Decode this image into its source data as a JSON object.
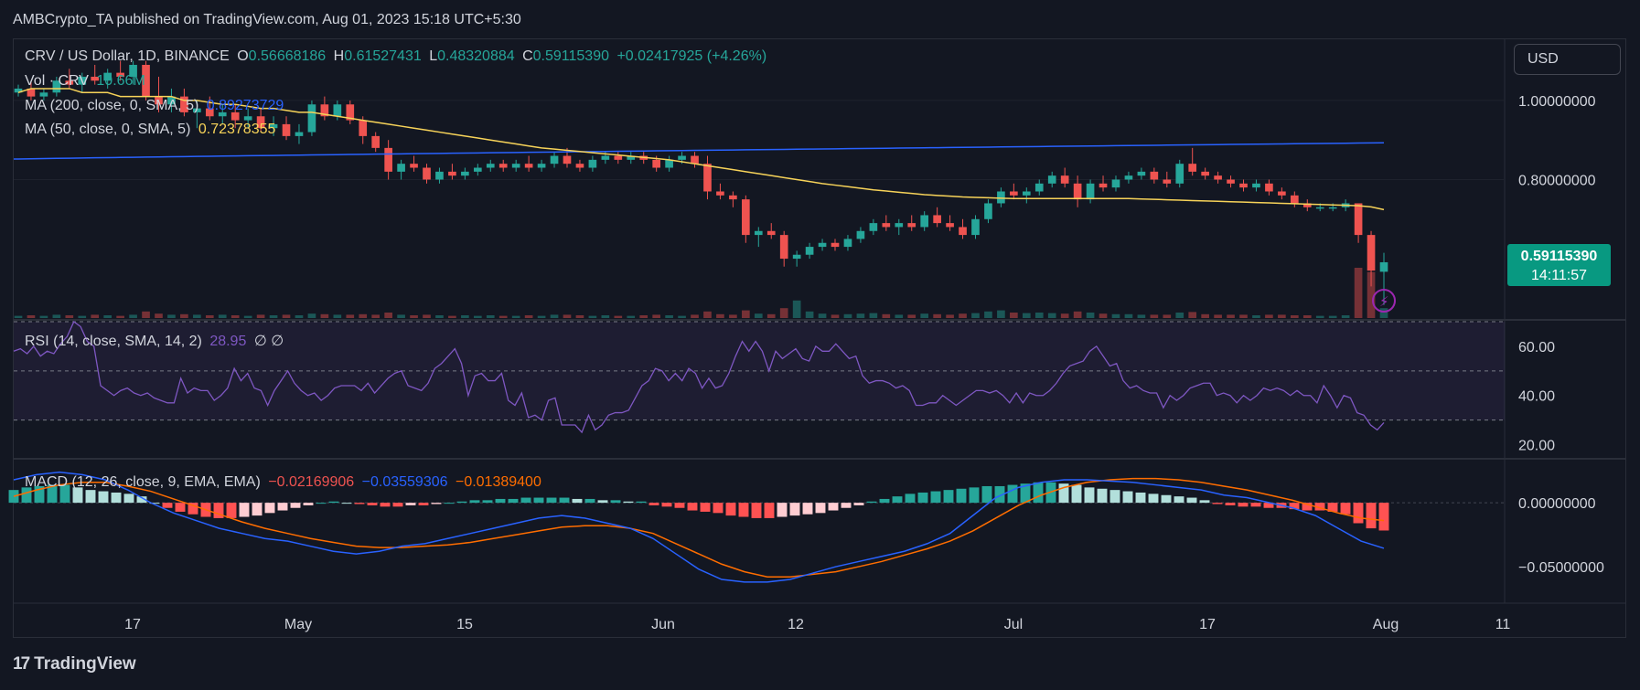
{
  "header": {
    "publisher": "AMBCrypto_TA published on TradingView.com, Aug 01, 2023 15:18 UTC+5:30"
  },
  "symbol": {
    "name": "CRV / US Dollar, 1D, BINANCE",
    "o_label": "O",
    "o": "0.56668186",
    "h_label": "H",
    "h": "0.61527431",
    "l_label": "L",
    "l": "0.48320884",
    "c_label": "C",
    "c": "0.59115390",
    "change": "+0.02417925 (+4.26%)"
  },
  "vol": {
    "label": "Vol · CRV",
    "value": "10.66M"
  },
  "ma200": {
    "label": "MA (200, close, 0, SMA, 5)",
    "value": "0.89273729"
  },
  "ma50": {
    "label": "MA (50, close, 0, SMA, 5)",
    "value": "0.72378355"
  },
  "rsi": {
    "label": "RSI (14, close, SMA, 14, 2)",
    "value": "28.95",
    "extra": "∅ ∅"
  },
  "macd": {
    "label": "MACD (12, 26, close, 9, EMA, EMA)",
    "v1": "−0.02169906",
    "v2": "−0.03559306",
    "v3": "−0.01389400"
  },
  "currency": "USD",
  "price_tag": {
    "price": "0.59115390",
    "countdown": "14:11:57"
  },
  "footer": {
    "brand": "TradingView",
    "logo": "17"
  },
  "colors": {
    "up": "#26a69a",
    "down": "#ef5350",
    "ma200": "#2962ff",
    "ma50": "#f7d359",
    "rsi": "#7e57c2",
    "macd": "#2962ff",
    "signal": "#ff6d00",
    "bg": "#131722"
  },
  "chart_data": {
    "type": "candlestick",
    "price_axis": {
      "ticks": [
        "1.00000000",
        "0.80000000"
      ],
      "range": [
        0.45,
        1.15
      ]
    },
    "x_ticks": [
      "17",
      "May",
      "15",
      "Jun",
      "12",
      "Jul",
      "17",
      "Aug",
      "11"
    ],
    "candles": [
      [
        1.02,
        1.04,
        1.01,
        1.03
      ],
      [
        1.03,
        1.05,
        1.0,
        1.01
      ],
      [
        1.01,
        1.03,
        1.0,
        1.02
      ],
      [
        1.02,
        1.06,
        1.01,
        1.05
      ],
      [
        1.05,
        1.08,
        1.03,
        1.04
      ],
      [
        1.04,
        1.07,
        1.02,
        1.06
      ],
      [
        1.06,
        1.09,
        1.04,
        1.05
      ],
      [
        1.05,
        1.08,
        1.03,
        1.07
      ],
      [
        1.07,
        1.1,
        1.05,
        1.06
      ],
      [
        1.06,
        1.1,
        1.04,
        1.09
      ],
      [
        1.09,
        1.1,
        1.0,
        1.01
      ],
      [
        1.01,
        1.06,
        0.97,
        0.99
      ],
      [
        0.99,
        1.03,
        0.97,
        1.01
      ],
      [
        1.01,
        1.03,
        0.96,
        0.97
      ],
      [
        0.97,
        1.0,
        0.93,
        0.98
      ],
      [
        0.98,
        1.01,
        0.95,
        0.96
      ],
      [
        0.96,
        0.99,
        0.94,
        0.97
      ],
      [
        0.97,
        0.99,
        0.93,
        0.95
      ],
      [
        0.95,
        0.98,
        0.93,
        0.96
      ],
      [
        0.96,
        0.98,
        0.92,
        0.93
      ],
      [
        0.93,
        0.96,
        0.91,
        0.94
      ],
      [
        0.94,
        0.96,
        0.9,
        0.91
      ],
      [
        0.91,
        0.94,
        0.89,
        0.92
      ],
      [
        0.92,
        1.0,
        0.91,
        0.99
      ],
      [
        0.99,
        1.01,
        0.95,
        0.96
      ],
      [
        0.96,
        1.0,
        0.95,
        0.99
      ],
      [
        0.99,
        1.0,
        0.94,
        0.95
      ],
      [
        0.95,
        0.96,
        0.89,
        0.91
      ],
      [
        0.91,
        0.92,
        0.87,
        0.88
      ],
      [
        0.88,
        0.9,
        0.8,
        0.82
      ],
      [
        0.82,
        0.85,
        0.8,
        0.84
      ],
      [
        0.84,
        0.86,
        0.82,
        0.83
      ],
      [
        0.83,
        0.84,
        0.79,
        0.8
      ],
      [
        0.8,
        0.83,
        0.79,
        0.82
      ],
      [
        0.82,
        0.84,
        0.8,
        0.81
      ],
      [
        0.81,
        0.83,
        0.8,
        0.82
      ],
      [
        0.82,
        0.84,
        0.81,
        0.83
      ],
      [
        0.83,
        0.85,
        0.82,
        0.84
      ],
      [
        0.84,
        0.85,
        0.82,
        0.83
      ],
      [
        0.83,
        0.85,
        0.82,
        0.84
      ],
      [
        0.84,
        0.86,
        0.82,
        0.83
      ],
      [
        0.83,
        0.85,
        0.82,
        0.84
      ],
      [
        0.84,
        0.87,
        0.83,
        0.86
      ],
      [
        0.86,
        0.88,
        0.83,
        0.84
      ],
      [
        0.84,
        0.85,
        0.82,
        0.83
      ],
      [
        0.83,
        0.86,
        0.82,
        0.85
      ],
      [
        0.85,
        0.87,
        0.84,
        0.86
      ],
      [
        0.86,
        0.87,
        0.84,
        0.85
      ],
      [
        0.85,
        0.87,
        0.84,
        0.86
      ],
      [
        0.86,
        0.87,
        0.84,
        0.85
      ],
      [
        0.85,
        0.86,
        0.82,
        0.83
      ],
      [
        0.83,
        0.86,
        0.82,
        0.85
      ],
      [
        0.85,
        0.87,
        0.84,
        0.86
      ],
      [
        0.86,
        0.87,
        0.83,
        0.84
      ],
      [
        0.84,
        0.86,
        0.75,
        0.77
      ],
      [
        0.77,
        0.79,
        0.75,
        0.76
      ],
      [
        0.76,
        0.77,
        0.73,
        0.75
      ],
      [
        0.75,
        0.76,
        0.64,
        0.66
      ],
      [
        0.66,
        0.68,
        0.63,
        0.67
      ],
      [
        0.67,
        0.69,
        0.65,
        0.66
      ],
      [
        0.66,
        0.67,
        0.58,
        0.6
      ],
      [
        0.6,
        0.62,
        0.58,
        0.61
      ],
      [
        0.61,
        0.64,
        0.6,
        0.63
      ],
      [
        0.63,
        0.65,
        0.62,
        0.64
      ],
      [
        0.64,
        0.65,
        0.62,
        0.63
      ],
      [
        0.63,
        0.66,
        0.62,
        0.65
      ],
      [
        0.65,
        0.68,
        0.64,
        0.67
      ],
      [
        0.67,
        0.7,
        0.66,
        0.69
      ],
      [
        0.69,
        0.71,
        0.67,
        0.68
      ],
      [
        0.68,
        0.7,
        0.66,
        0.69
      ],
      [
        0.69,
        0.71,
        0.67,
        0.68
      ],
      [
        0.68,
        0.72,
        0.67,
        0.71
      ],
      [
        0.71,
        0.73,
        0.68,
        0.69
      ],
      [
        0.69,
        0.71,
        0.67,
        0.68
      ],
      [
        0.68,
        0.7,
        0.65,
        0.66
      ],
      [
        0.66,
        0.71,
        0.65,
        0.7
      ],
      [
        0.7,
        0.75,
        0.69,
        0.74
      ],
      [
        0.74,
        0.78,
        0.73,
        0.77
      ],
      [
        0.77,
        0.79,
        0.75,
        0.76
      ],
      [
        0.76,
        0.78,
        0.74,
        0.77
      ],
      [
        0.77,
        0.8,
        0.76,
        0.79
      ],
      [
        0.79,
        0.82,
        0.78,
        0.81
      ],
      [
        0.81,
        0.83,
        0.78,
        0.79
      ],
      [
        0.79,
        0.81,
        0.73,
        0.75
      ],
      [
        0.75,
        0.8,
        0.74,
        0.79
      ],
      [
        0.79,
        0.81,
        0.77,
        0.78
      ],
      [
        0.78,
        0.81,
        0.77,
        0.8
      ],
      [
        0.8,
        0.82,
        0.79,
        0.81
      ],
      [
        0.81,
        0.83,
        0.8,
        0.82
      ],
      [
        0.82,
        0.83,
        0.79,
        0.8
      ],
      [
        0.8,
        0.82,
        0.78,
        0.79
      ],
      [
        0.79,
        0.85,
        0.78,
        0.84
      ],
      [
        0.84,
        0.88,
        0.81,
        0.82
      ],
      [
        0.82,
        0.83,
        0.8,
        0.81
      ],
      [
        0.81,
        0.82,
        0.79,
        0.8
      ],
      [
        0.8,
        0.81,
        0.78,
        0.79
      ],
      [
        0.79,
        0.8,
        0.77,
        0.78
      ],
      [
        0.78,
        0.8,
        0.77,
        0.79
      ],
      [
        0.79,
        0.8,
        0.76,
        0.77
      ],
      [
        0.77,
        0.78,
        0.75,
        0.76
      ],
      [
        0.76,
        0.77,
        0.73,
        0.74
      ],
      [
        0.74,
        0.75,
        0.72,
        0.73
      ],
      [
        0.73,
        0.74,
        0.72,
        0.73
      ],
      [
        0.73,
        0.74,
        0.72,
        0.73
      ],
      [
        0.73,
        0.75,
        0.72,
        0.74
      ],
      [
        0.74,
        0.74,
        0.64,
        0.66
      ],
      [
        0.66,
        0.67,
        0.53,
        0.57
      ],
      [
        0.567,
        0.615,
        0.483,
        0.591
      ]
    ],
    "volume_relative": [
      0.2,
      0.25,
      0.2,
      0.3,
      0.25,
      0.2,
      0.3,
      0.25,
      0.2,
      0.3,
      0.6,
      0.4,
      0.3,
      0.35,
      0.3,
      0.25,
      0.3,
      0.25,
      0.2,
      0.3,
      0.25,
      0.3,
      0.25,
      0.4,
      0.35,
      0.3,
      0.3,
      0.35,
      0.3,
      0.5,
      0.3,
      0.25,
      0.3,
      0.25,
      0.2,
      0.25,
      0.2,
      0.25,
      0.2,
      0.2,
      0.25,
      0.2,
      0.3,
      0.3,
      0.25,
      0.2,
      0.25,
      0.2,
      0.2,
      0.25,
      0.3,
      0.25,
      0.2,
      0.3,
      0.6,
      0.35,
      0.3,
      0.7,
      0.4,
      0.35,
      0.9,
      1.6,
      0.6,
      0.4,
      0.3,
      0.35,
      0.4,
      0.45,
      0.35,
      0.3,
      0.3,
      0.4,
      0.35,
      0.3,
      0.4,
      0.45,
      0.6,
      0.7,
      0.5,
      0.45,
      0.5,
      0.45,
      0.4,
      0.6,
      0.5,
      0.4,
      0.35,
      0.35,
      0.3,
      0.3,
      0.3,
      0.5,
      0.55,
      0.35,
      0.3,
      0.3,
      0.3,
      0.25,
      0.3,
      0.3,
      0.25,
      0.25,
      0.2,
      0.2,
      0.25,
      4.8,
      4.2,
      0.9
    ],
    "ma200": {
      "start": 0.852,
      "end": 0.893
    },
    "ma50": [
      1.02,
      1.03,
      1.03,
      1.03,
      1.03,
      1.02,
      1.02,
      1.02,
      1.01,
      1.01,
      1.01,
      1.01,
      1.01,
      1.0,
      1.0,
      0.995,
      0.99,
      0.99,
      0.985,
      0.98,
      0.98,
      0.975,
      0.97,
      0.97,
      0.965,
      0.96,
      0.955,
      0.95,
      0.945,
      0.94,
      0.935,
      0.93,
      0.925,
      0.92,
      0.915,
      0.91,
      0.905,
      0.9,
      0.895,
      0.89,
      0.885,
      0.88,
      0.877,
      0.874,
      0.871,
      0.868,
      0.865,
      0.862,
      0.859,
      0.856,
      0.853,
      0.85,
      0.845,
      0.84,
      0.835,
      0.83,
      0.825,
      0.82,
      0.815,
      0.81,
      0.805,
      0.8,
      0.795,
      0.79,
      0.786,
      0.782,
      0.778,
      0.774,
      0.771,
      0.768,
      0.765,
      0.762,
      0.76,
      0.758,
      0.756,
      0.755,
      0.754,
      0.753,
      0.752,
      0.752,
      0.752,
      0.752,
      0.752,
      0.752,
      0.752,
      0.752,
      0.752,
      0.752,
      0.751,
      0.75,
      0.749,
      0.748,
      0.747,
      0.746,
      0.745,
      0.744,
      0.743,
      0.742,
      0.741,
      0.74,
      0.739,
      0.738,
      0.737,
      0.736,
      0.735,
      0.734,
      0.731,
      0.724
    ],
    "rsi": {
      "ticks": [
        "60.00",
        "40.00",
        "20.00"
      ],
      "range": [
        15,
        70
      ],
      "band": [
        30,
        70
      ],
      "values": [
        58,
        59,
        57,
        60,
        56,
        58,
        57,
        61,
        64,
        70,
        68,
        62,
        60,
        44,
        42,
        40,
        42,
        43,
        41,
        40,
        41,
        39,
        38,
        37,
        37,
        47,
        41,
        43,
        42,
        42,
        38,
        40,
        43,
        51,
        46,
        49,
        43,
        42,
        36,
        42,
        46,
        50,
        45,
        42,
        40,
        41,
        38,
        40,
        43,
        44,
        44,
        44,
        42,
        45,
        41,
        44,
        47,
        49,
        50,
        44,
        43,
        42,
        45,
        51,
        53,
        56,
        59,
        53,
        40,
        48,
        49,
        46,
        46,
        49,
        38,
        36,
        41,
        31,
        32,
        30,
        38,
        39,
        28,
        28,
        28,
        25,
        32,
        26,
        28,
        32,
        33,
        33,
        34,
        39,
        44,
        46,
        51,
        50,
        46,
        49,
        46,
        51,
        49,
        43,
        47,
        43,
        44,
        49,
        56,
        62,
        58,
        62,
        58,
        50,
        58,
        55,
        57,
        59,
        55,
        54,
        60,
        58,
        58,
        61,
        58,
        55,
        56,
        48,
        45,
        46,
        46,
        45,
        43,
        44,
        42,
        36,
        36,
        37,
        37,
        40,
        38,
        36,
        38,
        40,
        42,
        42,
        41,
        42,
        40,
        37,
        41,
        37,
        41,
        40,
        40,
        42,
        45,
        49,
        52,
        53,
        54,
        58,
        60,
        56,
        52,
        53,
        46,
        43,
        44,
        42,
        41,
        41,
        35,
        40,
        38,
        40,
        43,
        44,
        45,
        45,
        40,
        41,
        40,
        37,
        40,
        38,
        40,
        43,
        42,
        43,
        42,
        40,
        42,
        40,
        40,
        37,
        44,
        40,
        35,
        40,
        39,
        33,
        32,
        28,
        26,
        28.95
      ]
    },
    "macd": {
      "ticks": [
        "0.00000000",
        "−0.05000000"
      ],
      "range": [
        -0.075,
        0.033
      ],
      "hist": [
        0.01,
        0.012,
        0.013,
        0.014,
        0.014,
        0.012,
        0.01,
        0.009,
        0.008,
        0.007,
        0.005,
        0.0,
        -0.004,
        -0.007,
        -0.009,
        -0.011,
        -0.012,
        -0.012,
        -0.011,
        -0.01,
        -0.008,
        -0.006,
        -0.004,
        -0.002,
        0.0,
        0.001,
        0.0,
        -0.001,
        -0.002,
        -0.003,
        -0.003,
        -0.002,
        -0.002,
        -0.001,
        0.0,
        0.001,
        0.002,
        0.002,
        0.003,
        0.003,
        0.004,
        0.004,
        0.004,
        0.004,
        0.003,
        0.003,
        0.002,
        0.002,
        0.001,
        0.001,
        -0.002,
        -0.003,
        -0.004,
        -0.006,
        -0.007,
        -0.008,
        -0.01,
        -0.011,
        -0.012,
        -0.012,
        -0.011,
        -0.01,
        -0.009,
        -0.008,
        -0.006,
        -0.004,
        -0.002,
        0.001,
        0.003,
        0.005,
        0.007,
        0.008,
        0.009,
        0.01,
        0.011,
        0.012,
        0.013,
        0.013,
        0.014,
        0.015,
        0.016,
        0.016,
        0.015,
        0.014,
        0.012,
        0.011,
        0.01,
        0.009,
        0.008,
        0.007,
        0.006,
        0.005,
        0.004,
        0.002,
        -0.001,
        -0.002,
        -0.003,
        -0.003,
        -0.004,
        -0.004,
        -0.005,
        -0.006,
        -0.006,
        -0.007,
        -0.009,
        -0.016,
        -0.02,
        -0.0217
      ],
      "macd": [
        0.018,
        0.022,
        0.024,
        0.022,
        0.018,
        0.01,
        0.0,
        -0.008,
        -0.014,
        -0.02,
        -0.024,
        -0.028,
        -0.03,
        -0.034,
        -0.038,
        -0.04,
        -0.038,
        -0.034,
        -0.032,
        -0.028,
        -0.024,
        -0.02,
        -0.016,
        -0.012,
        -0.01,
        -0.012,
        -0.016,
        -0.02,
        -0.028,
        -0.04,
        -0.052,
        -0.06,
        -0.062,
        -0.062,
        -0.06,
        -0.055,
        -0.05,
        -0.046,
        -0.042,
        -0.038,
        -0.032,
        -0.024,
        -0.01,
        0.004,
        0.012,
        0.016,
        0.018,
        0.018,
        0.017,
        0.016,
        0.014,
        0.012,
        0.01,
        0.006,
        0.004,
        0.0,
        -0.004,
        -0.01,
        -0.02,
        -0.03,
        -0.0356
      ],
      "signal": [
        0.005,
        0.01,
        0.014,
        0.016,
        0.016,
        0.013,
        0.009,
        0.003,
        -0.003,
        -0.009,
        -0.015,
        -0.02,
        -0.024,
        -0.028,
        -0.031,
        -0.034,
        -0.035,
        -0.035,
        -0.034,
        -0.033,
        -0.031,
        -0.028,
        -0.025,
        -0.022,
        -0.019,
        -0.018,
        -0.018,
        -0.02,
        -0.024,
        -0.032,
        -0.04,
        -0.048,
        -0.054,
        -0.058,
        -0.058,
        -0.056,
        -0.054,
        -0.05,
        -0.046,
        -0.041,
        -0.036,
        -0.03,
        -0.022,
        -0.012,
        -0.002,
        0.006,
        0.012,
        0.016,
        0.018,
        0.019,
        0.019,
        0.018,
        0.016,
        0.013,
        0.01,
        0.006,
        0.002,
        -0.003,
        -0.008,
        -0.012,
        -0.0139
      ]
    }
  }
}
